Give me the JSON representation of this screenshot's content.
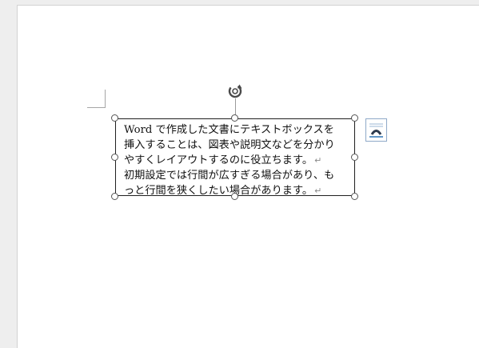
{
  "document": {
    "textbox": {
      "lines": [
        "Word で作成した文書にテキストボックスを",
        "挿入することは、図表や説明文などを分かり",
        "やすくレイアウトするのに役立ちます。",
        "初期設定では行間が広すぎる場合があり、も",
        "っと行間を狭くしたい場合があります。"
      ],
      "paragraph_mark": "↵"
    }
  },
  "icons": {
    "rotate": "rotate-handle-icon",
    "layout_options": "layout-options-icon",
    "resize_handle": "resize-handle-icon"
  },
  "colors": {
    "page": "#ffffff",
    "background": "#eeeeee",
    "textbox_border": "#1f1f1f",
    "handle_border": "#555555",
    "layout_icon_accent": "#2e75b6"
  }
}
